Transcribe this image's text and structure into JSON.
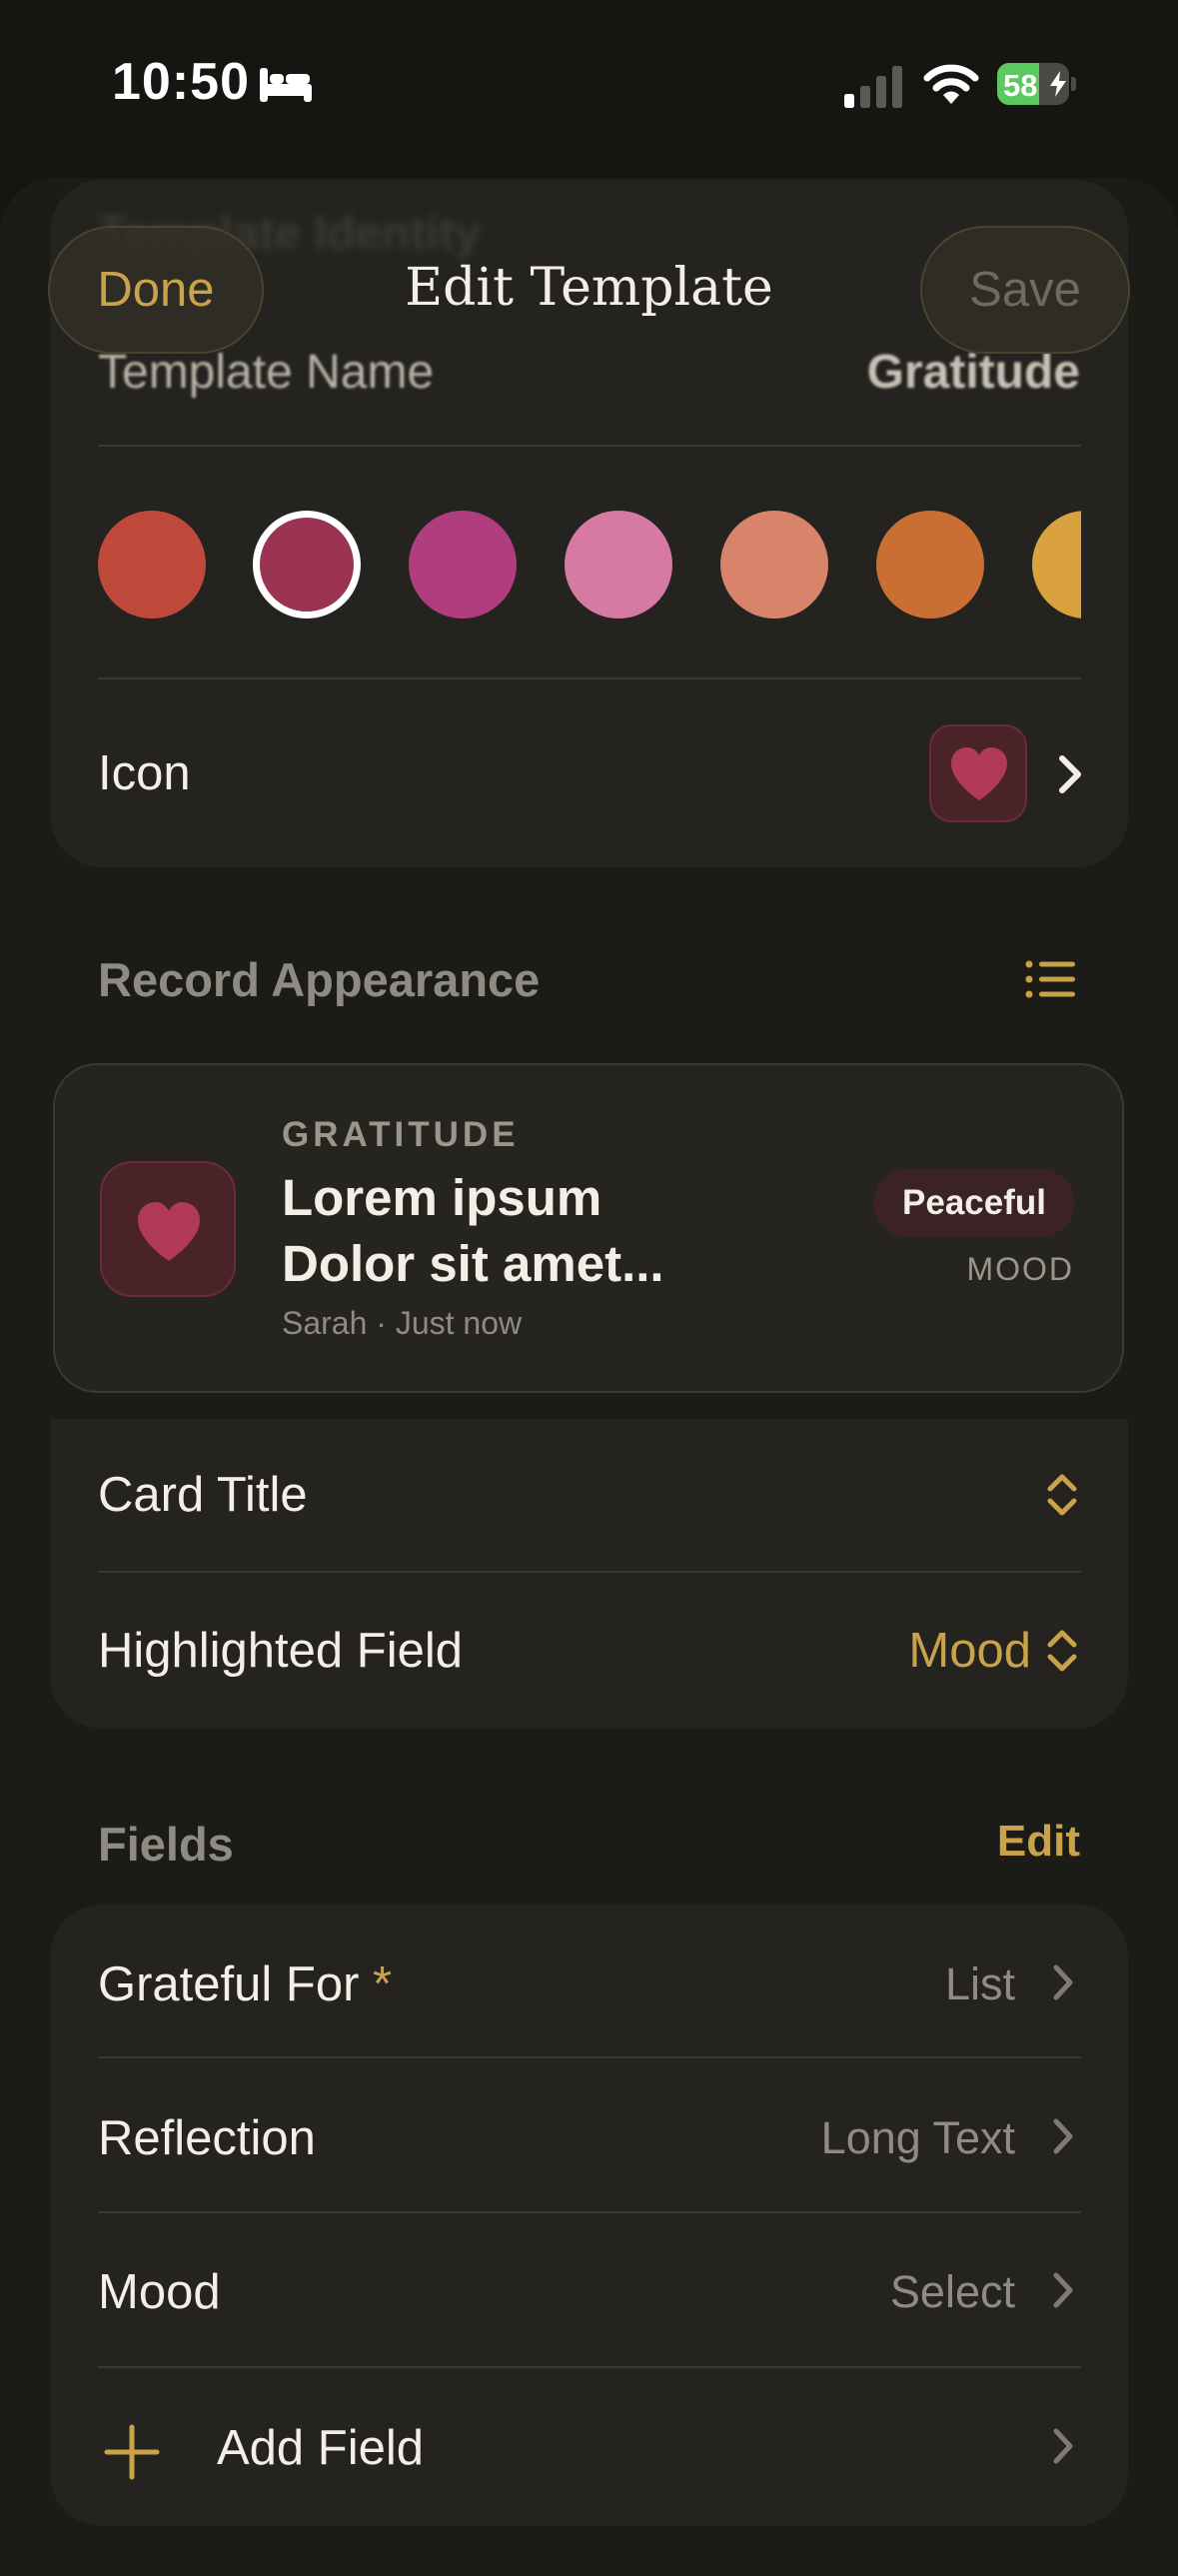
{
  "status_bar": {
    "time": "10:50",
    "battery_percent": 58,
    "battery_label": "58",
    "icons": [
      "bed-icon",
      "cellular-signal-icon",
      "wifi-icon",
      "battery-charging-icon"
    ]
  },
  "header": {
    "done_label": "Done",
    "title": "Edit Template",
    "save_label": "Save"
  },
  "identity": {
    "section_title": "Template Identity",
    "name_label": "Template Name",
    "name_value": "Gratitude",
    "colors": [
      "#bf4a3c",
      "#9b3452",
      "#b03d7d",
      "#d67aa3",
      "#d8846a",
      "#c96f33",
      "#d9a23e"
    ],
    "selected_color_index": 1,
    "icon_label": "Icon",
    "icon_name": "heart-icon",
    "icon_color": "#b13a5a"
  },
  "record_appearance": {
    "section_title": "Record Appearance",
    "layout_icon": "list-icon",
    "preview": {
      "kicker": "GRATITUDE",
      "title_line1": "Lorem ipsum",
      "title_line2": "Dolor sit amet...",
      "meta": "Sarah · Just now",
      "badge": "Peaceful",
      "badge_caption": "MOOD"
    },
    "card_title_label": "Card Title",
    "highlighted_label": "Highlighted Field",
    "highlighted_value": "Mood"
  },
  "fields": {
    "section_title": "Fields",
    "edit_label": "Edit",
    "items": [
      {
        "label": "Grateful For",
        "required_mark": "*",
        "type": "List"
      },
      {
        "label": "Reflection",
        "type": "Long Text"
      },
      {
        "label": "Mood",
        "type": "Select"
      }
    ],
    "add_label": "Add Field"
  },
  "colors": {
    "accent": "#c9a24a",
    "background": "#151511",
    "card": "#24231f"
  }
}
